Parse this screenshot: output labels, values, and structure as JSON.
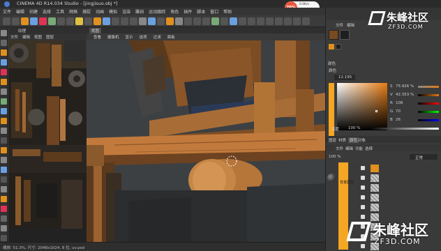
{
  "window": {
    "title": "CINEMA 4D R14.034 Studio - [jingjisuo.obj *]"
  },
  "menubar": [
    "文件",
    "编辑",
    "创建",
    "选择",
    "工具",
    "网格",
    "捕捉",
    "动画",
    "模拟",
    "渲染",
    "雕刻",
    "运动跟踪",
    "角色",
    "插件",
    "脚本",
    "窗口",
    "帮助"
  ],
  "perf": {
    "percent": "76%",
    "up": "0.0K/s",
    "down": "0K/s"
  },
  "texture_panel": {
    "tab": "纹理",
    "menu": [
      "文件",
      "编辑",
      "视图",
      "图层"
    ]
  },
  "viewport": {
    "tab": "视图",
    "menu": [
      "查看",
      "摄像机",
      "显示",
      "选项",
      "过滤",
      "面板"
    ]
  },
  "status": {
    "text": "缩放: 51.3%, 尺寸: 2048x1024, 8 位, uv.psd"
  },
  "right_panel": {
    "top_tabs": [
      "文件",
      "编辑"
    ],
    "attr_label": "颜色",
    "color_mode": "颜色",
    "color_value": "12.195",
    "hsv": [
      {
        "label": "S",
        "value": "75.926 %"
      },
      {
        "label": "V",
        "value": "42.353 %"
      },
      {
        "label": "R",
        "value": "108"
      },
      {
        "label": "G",
        "value": "70"
      },
      {
        "label": "B",
        "value": "26"
      }
    ],
    "brightness_label": "亮度",
    "brightness_value": "100 %",
    "tabs2": [
      "图层",
      "材质",
      "颜色",
      "对象"
    ],
    "layer_menu": [
      "文件",
      "编辑",
      "功能",
      "选择"
    ],
    "opacity": "100 %",
    "blend": "正常",
    "layer_name": "背景图层"
  },
  "watermark": {
    "top_cn": "朱峰社区",
    "top_en": "ZF3D.COM",
    "bot_cn": "朱峰社区",
    "bot_en": "ZF3D.COM"
  },
  "colors": {
    "wood_light": "#b8783a",
    "wood_dark": "#6b3e1c",
    "accent_orange": "#f5a623",
    "bg_grey": "#3f4245"
  }
}
